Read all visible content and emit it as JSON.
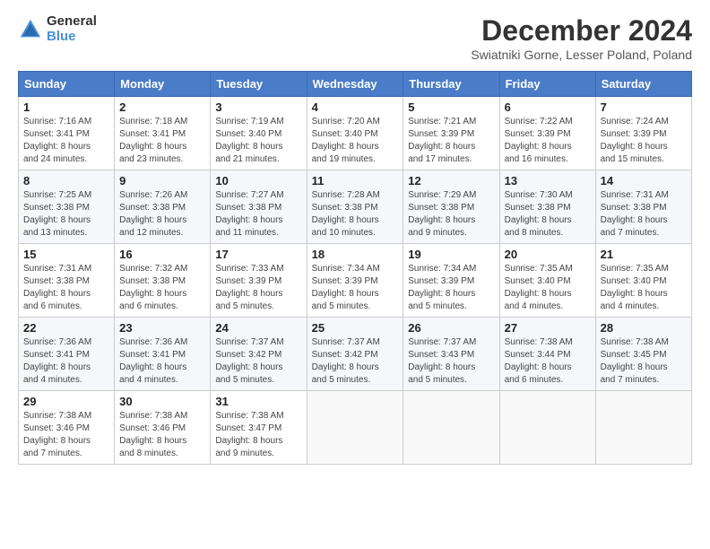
{
  "header": {
    "logo_line1": "General",
    "logo_line2": "Blue",
    "month_title": "December 2024",
    "location": "Swiatniki Gorne, Lesser Poland, Poland"
  },
  "weekdays": [
    "Sunday",
    "Monday",
    "Tuesday",
    "Wednesday",
    "Thursday",
    "Friday",
    "Saturday"
  ],
  "weeks": [
    [
      {
        "day": "1",
        "info": "Sunrise: 7:16 AM\nSunset: 3:41 PM\nDaylight: 8 hours\nand 24 minutes."
      },
      {
        "day": "2",
        "info": "Sunrise: 7:18 AM\nSunset: 3:41 PM\nDaylight: 8 hours\nand 23 minutes."
      },
      {
        "day": "3",
        "info": "Sunrise: 7:19 AM\nSunset: 3:40 PM\nDaylight: 8 hours\nand 21 minutes."
      },
      {
        "day": "4",
        "info": "Sunrise: 7:20 AM\nSunset: 3:40 PM\nDaylight: 8 hours\nand 19 minutes."
      },
      {
        "day": "5",
        "info": "Sunrise: 7:21 AM\nSunset: 3:39 PM\nDaylight: 8 hours\nand 17 minutes."
      },
      {
        "day": "6",
        "info": "Sunrise: 7:22 AM\nSunset: 3:39 PM\nDaylight: 8 hours\nand 16 minutes."
      },
      {
        "day": "7",
        "info": "Sunrise: 7:24 AM\nSunset: 3:39 PM\nDaylight: 8 hours\nand 15 minutes."
      }
    ],
    [
      {
        "day": "8",
        "info": "Sunrise: 7:25 AM\nSunset: 3:38 PM\nDaylight: 8 hours\nand 13 minutes."
      },
      {
        "day": "9",
        "info": "Sunrise: 7:26 AM\nSunset: 3:38 PM\nDaylight: 8 hours\nand 12 minutes."
      },
      {
        "day": "10",
        "info": "Sunrise: 7:27 AM\nSunset: 3:38 PM\nDaylight: 8 hours\nand 11 minutes."
      },
      {
        "day": "11",
        "info": "Sunrise: 7:28 AM\nSunset: 3:38 PM\nDaylight: 8 hours\nand 10 minutes."
      },
      {
        "day": "12",
        "info": "Sunrise: 7:29 AM\nSunset: 3:38 PM\nDaylight: 8 hours\nand 9 minutes."
      },
      {
        "day": "13",
        "info": "Sunrise: 7:30 AM\nSunset: 3:38 PM\nDaylight: 8 hours\nand 8 minutes."
      },
      {
        "day": "14",
        "info": "Sunrise: 7:31 AM\nSunset: 3:38 PM\nDaylight: 8 hours\nand 7 minutes."
      }
    ],
    [
      {
        "day": "15",
        "info": "Sunrise: 7:31 AM\nSunset: 3:38 PM\nDaylight: 8 hours\nand 6 minutes."
      },
      {
        "day": "16",
        "info": "Sunrise: 7:32 AM\nSunset: 3:38 PM\nDaylight: 8 hours\nand 6 minutes."
      },
      {
        "day": "17",
        "info": "Sunrise: 7:33 AM\nSunset: 3:39 PM\nDaylight: 8 hours\nand 5 minutes."
      },
      {
        "day": "18",
        "info": "Sunrise: 7:34 AM\nSunset: 3:39 PM\nDaylight: 8 hours\nand 5 minutes."
      },
      {
        "day": "19",
        "info": "Sunrise: 7:34 AM\nSunset: 3:39 PM\nDaylight: 8 hours\nand 5 minutes."
      },
      {
        "day": "20",
        "info": "Sunrise: 7:35 AM\nSunset: 3:40 PM\nDaylight: 8 hours\nand 4 minutes."
      },
      {
        "day": "21",
        "info": "Sunrise: 7:35 AM\nSunset: 3:40 PM\nDaylight: 8 hours\nand 4 minutes."
      }
    ],
    [
      {
        "day": "22",
        "info": "Sunrise: 7:36 AM\nSunset: 3:41 PM\nDaylight: 8 hours\nand 4 minutes."
      },
      {
        "day": "23",
        "info": "Sunrise: 7:36 AM\nSunset: 3:41 PM\nDaylight: 8 hours\nand 4 minutes."
      },
      {
        "day": "24",
        "info": "Sunrise: 7:37 AM\nSunset: 3:42 PM\nDaylight: 8 hours\nand 5 minutes."
      },
      {
        "day": "25",
        "info": "Sunrise: 7:37 AM\nSunset: 3:42 PM\nDaylight: 8 hours\nand 5 minutes."
      },
      {
        "day": "26",
        "info": "Sunrise: 7:37 AM\nSunset: 3:43 PM\nDaylight: 8 hours\nand 5 minutes."
      },
      {
        "day": "27",
        "info": "Sunrise: 7:38 AM\nSunset: 3:44 PM\nDaylight: 8 hours\nand 6 minutes."
      },
      {
        "day": "28",
        "info": "Sunrise: 7:38 AM\nSunset: 3:45 PM\nDaylight: 8 hours\nand 7 minutes."
      }
    ],
    [
      {
        "day": "29",
        "info": "Sunrise: 7:38 AM\nSunset: 3:46 PM\nDaylight: 8 hours\nand 7 minutes."
      },
      {
        "day": "30",
        "info": "Sunrise: 7:38 AM\nSunset: 3:46 PM\nDaylight: 8 hours\nand 8 minutes."
      },
      {
        "day": "31",
        "info": "Sunrise: 7:38 AM\nSunset: 3:47 PM\nDaylight: 8 hours\nand 9 minutes."
      },
      null,
      null,
      null,
      null
    ]
  ]
}
